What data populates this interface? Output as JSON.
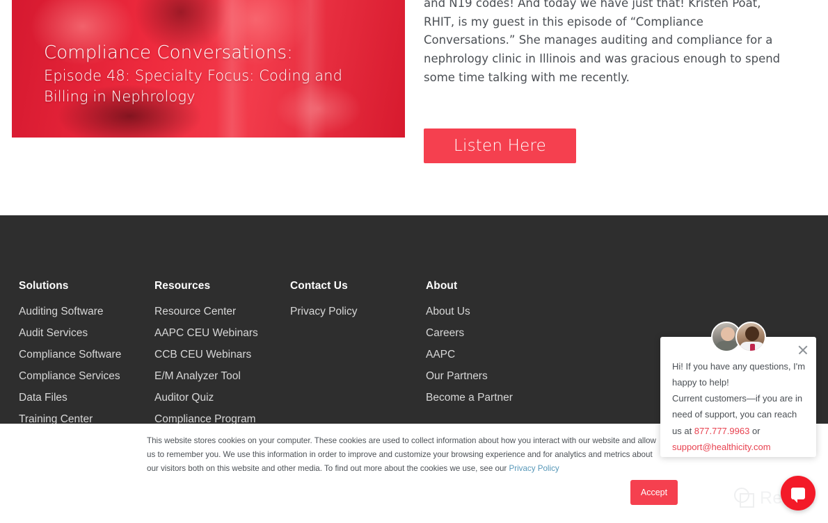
{
  "article": {
    "banner": {
      "title_line1": "Compliance Conversations:",
      "title_line2": "Episode 48: Specialty Focus: Coding and Billing in Nephrology",
      "alt": "podcast-episode-banner"
    },
    "body_text": "and N19 codes! And today we have just that! Kristen Poat, RHIT, is my guest in this episode of “Compliance Conversations.” She manages auditing and compliance for a nephrology clinic in Illinois and was gracious enough to spend some time talking with me recently.",
    "listen_button": "Listen Here"
  },
  "footer": {
    "columns": [
      {
        "heading": "Solutions",
        "links": [
          "Auditing Software",
          "Audit Services",
          "Compliance Software",
          "Compliance Services",
          "Data Files",
          "Training Center"
        ]
      },
      {
        "heading": "Resources",
        "links": [
          "Resource Center",
          "AAPC CEU Webinars",
          "CCB CEU Webinars",
          "E/M Analyzer Tool",
          "Auditor Quiz",
          "Compliance Program Grader"
        ]
      },
      {
        "heading": "Contact Us",
        "links": [
          "Privacy Policy"
        ]
      },
      {
        "heading": "About",
        "links": [
          "About Us",
          "Careers",
          "AAPC",
          "Our Partners",
          "Become a Partner"
        ]
      }
    ]
  },
  "cookie_banner": {
    "text": "This website stores cookies on your computer. These cookies are used to collect information about how you interact with our website and allow us to remember you. We use this information in order to improve and customize your browsing experience and for analytics and metrics about our visitors both on this website and other media. To find out more about the cookies we use, see our ",
    "privacy_link": "Privacy Policy",
    "accept_button": "Accept"
  },
  "chat_widget": {
    "greeting": "Hi! If you have any questions, I'm happy to help!",
    "support_intro": "Current customers—if you are in need of support, you can reach us at ",
    "phone": "877.777.9963",
    "conjunction": " or",
    "email": "support@healthicity.com"
  },
  "watermark": {
    "label": "Revain"
  },
  "colors": {
    "accent_red": "#f5404f",
    "launcher_red": "#f31a28",
    "footer_bg": "#2e2e2e",
    "footer_link": "#d7d7d7",
    "cookie_link": "#5697b8"
  }
}
